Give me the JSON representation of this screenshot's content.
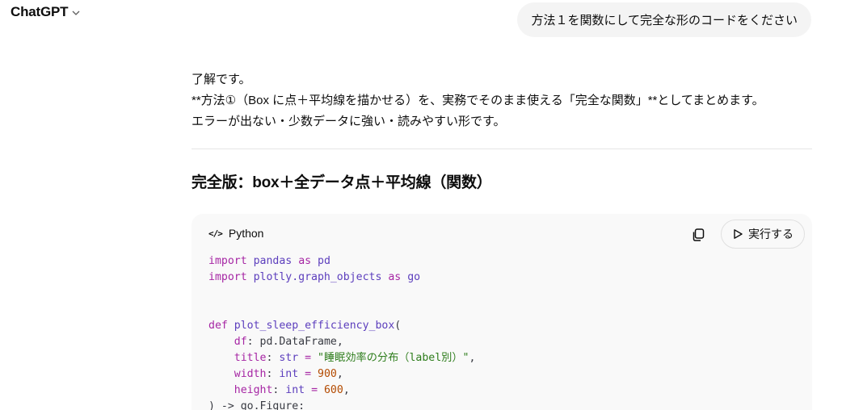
{
  "header": {
    "app_title": "ChatGPT"
  },
  "user_message": "方法１を関数にして完全な形のコードをください",
  "assistant": {
    "lines": [
      "了解です。",
      "**方法①（Box に点＋平均線を描かせる）を、実務でそのまま使える「完全な関数」**としてまとめます。",
      "エラーが出ない・少数データに強い・読みやすい形です。"
    ],
    "heading": "完全版：box＋全データ点＋平均線（関数）"
  },
  "code_block": {
    "language": "Python",
    "run_label": "実行する",
    "tokens": {
      "import": "import",
      "pandas": "pandas",
      "as": "as",
      "pd": "pd",
      "plotly_graph_objects": "plotly.graph_objects",
      "go": "go",
      "def": "def",
      "func_name": "plot_sleep_efficiency_box",
      "df": "df",
      "pd_dataframe": "pd.DataFrame",
      "title": "title",
      "str": "str",
      "title_default": "\"睡眠効率の分布（label別）\"",
      "width": "width",
      "int": "int",
      "width_default": "900",
      "height": "height",
      "height_default": "600",
      "return_annot": ") -> go.Figure:"
    }
  },
  "colors": {
    "keyword": "#a626a4",
    "function": "#5c3ebd",
    "string": "#2e7d1c",
    "number": "#b34a00",
    "bubble_bg": "#f4f4f4",
    "code_bg": "#f9f9f9"
  },
  "icons": [
    "chevron-down-icon",
    "code-icon",
    "copy-icon",
    "play-icon"
  ]
}
